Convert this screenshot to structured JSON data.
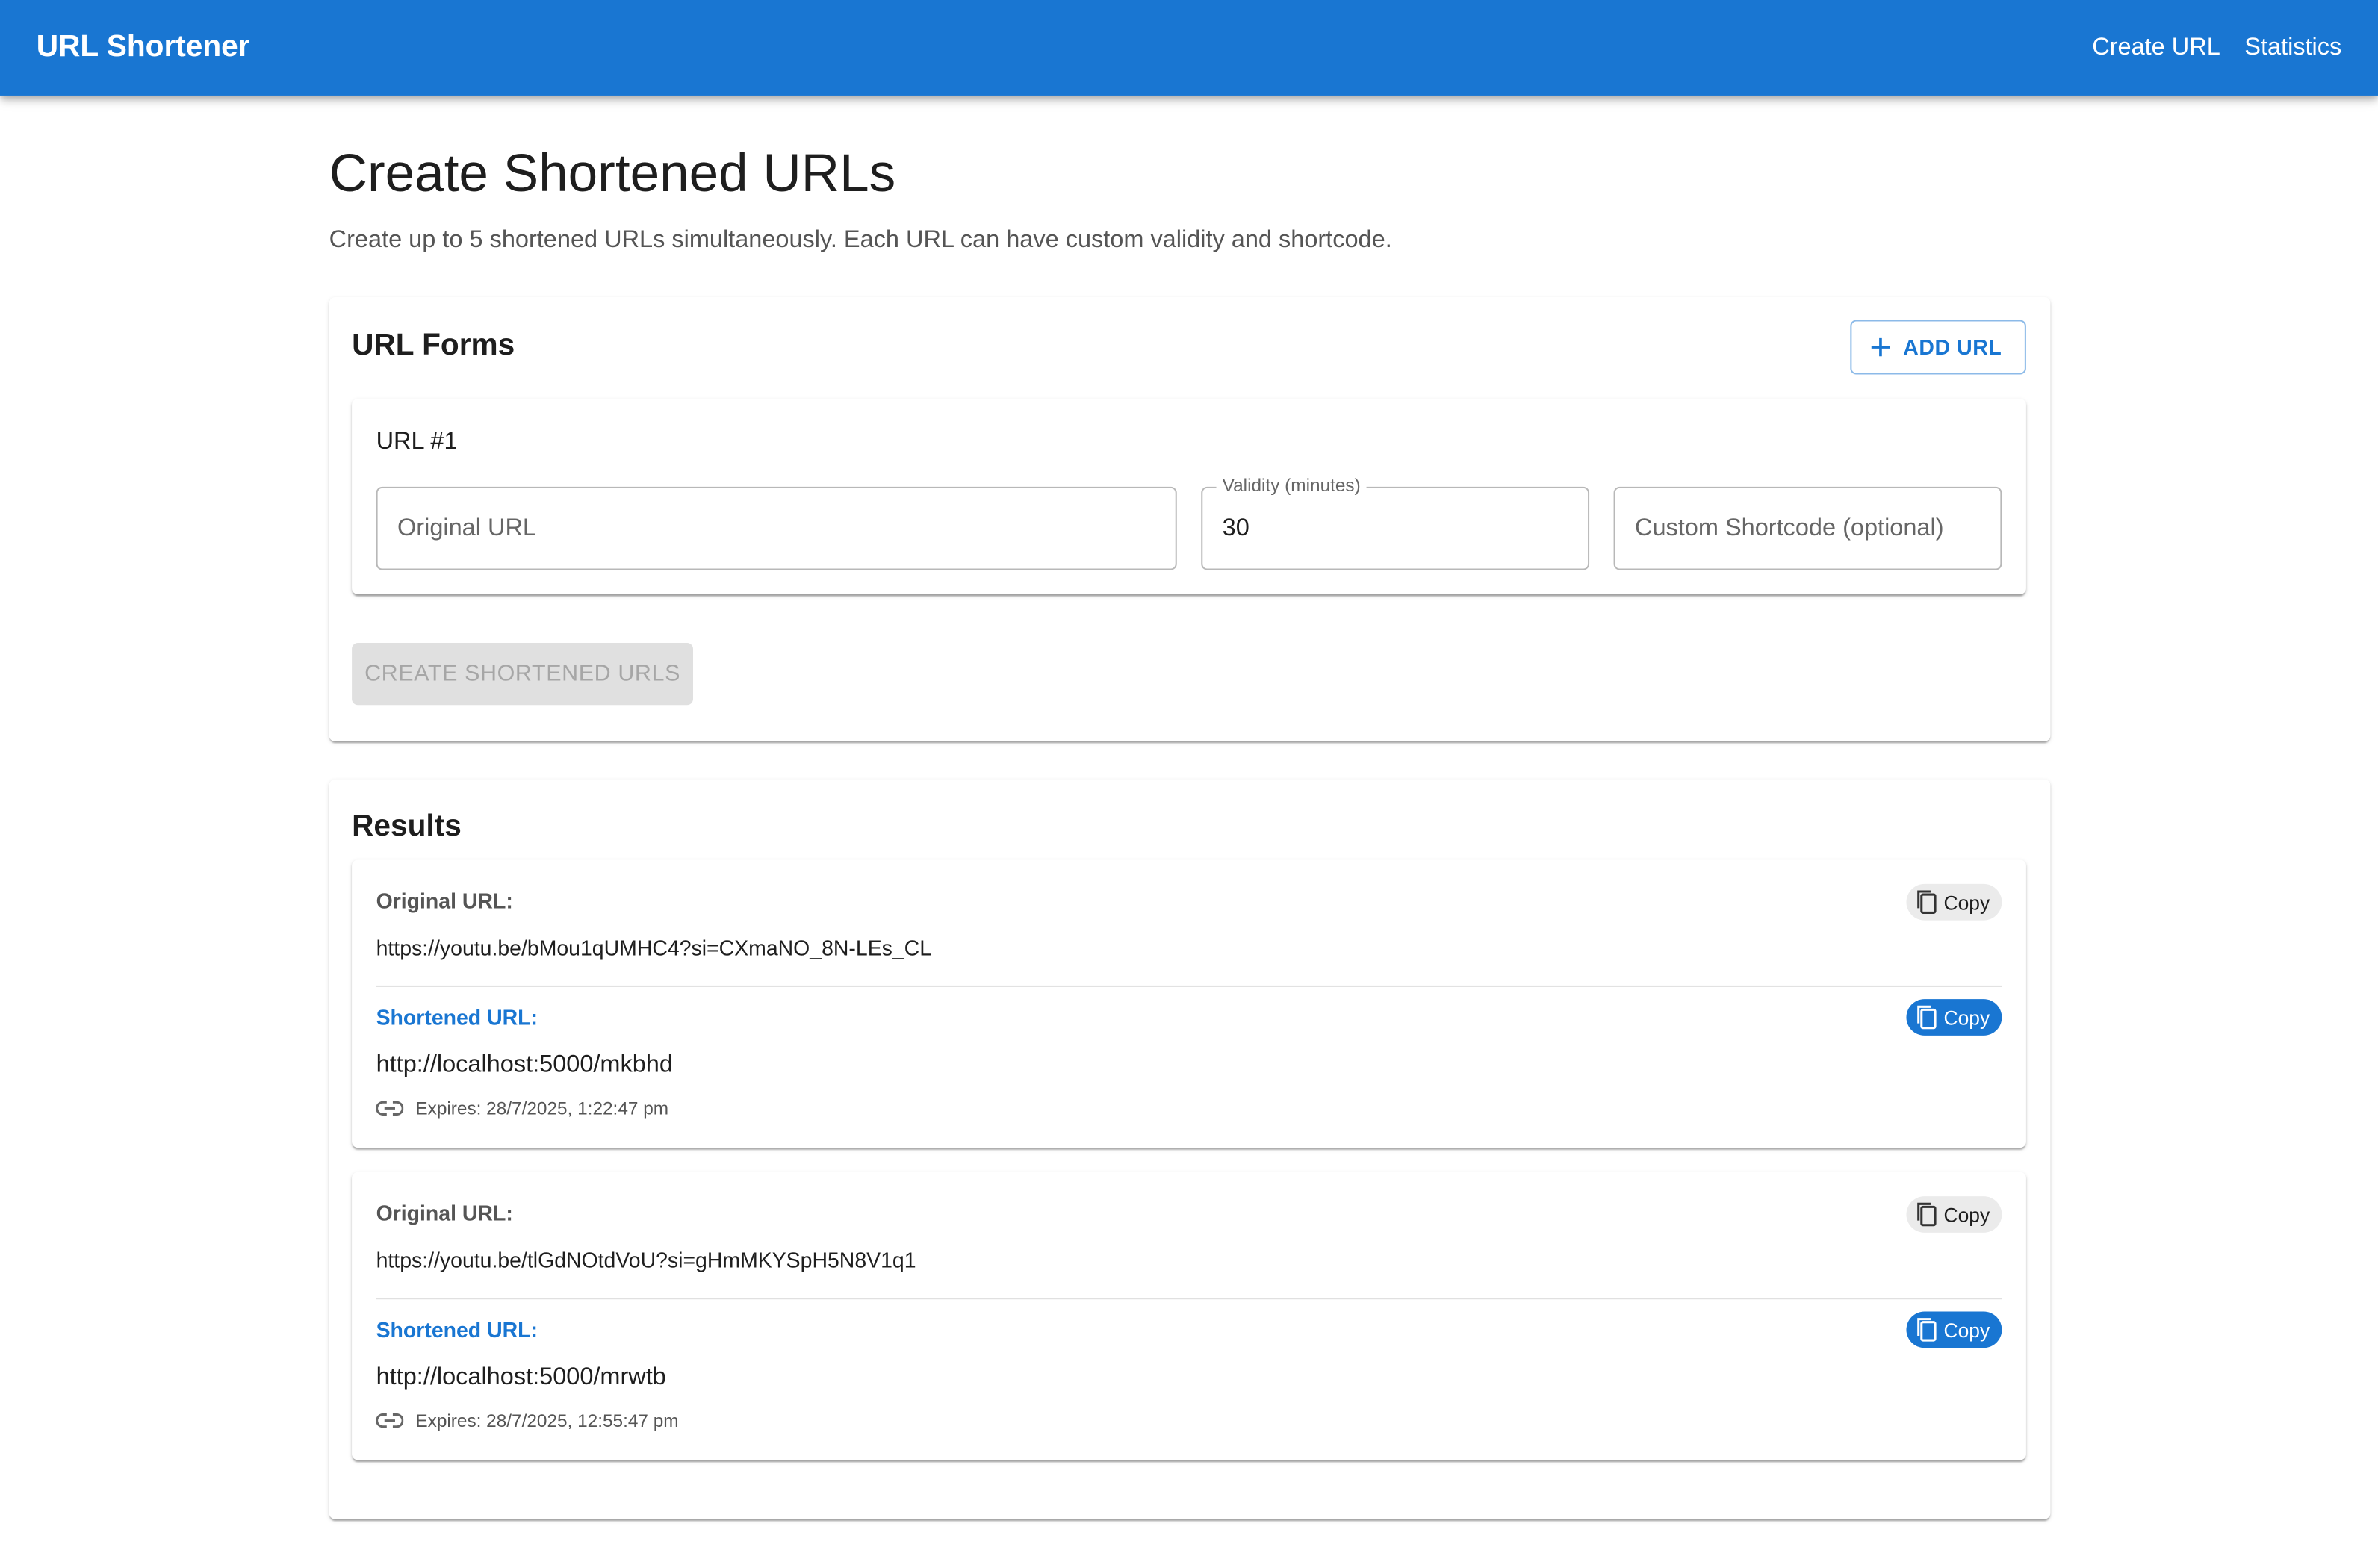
{
  "header": {
    "title": "URL Shortener",
    "nav": [
      "Create URL",
      "Statistics"
    ]
  },
  "page": {
    "title": "Create Shortened URLs",
    "subtitle": "Create up to 5 shortened URLs simultaneously. Each URL can have custom validity and shortcode."
  },
  "forms": {
    "title": "URL Forms",
    "add_label": "ADD URL",
    "items": [
      {
        "label": "URL #1",
        "original_placeholder": "Original URL",
        "validity_label": "Validity (minutes)",
        "validity_value": "30",
        "shortcode_placeholder": "Custom Shortcode (optional)"
      }
    ],
    "create_label": "CREATE SHORTENED URLS"
  },
  "results": {
    "title": "Results",
    "original_label": "Original URL:",
    "shortened_label": "Shortened URL:",
    "copy_label": "Copy",
    "items": [
      {
        "original": "https://youtu.be/bMou1qUMHC4?si=CXmaNO_8N-LEs_CL",
        "shortened": "http://localhost:5000/mkbhd",
        "expires": "Expires: 28/7/2025, 1:22:47 pm"
      },
      {
        "original": "https://youtu.be/tlGdNOtdVoU?si=gHmMKYSpH5N8V1q1",
        "shortened": "http://localhost:5000/mrwtb",
        "expires": "Expires: 28/7/2025, 12:55:47 pm"
      }
    ]
  },
  "colors": {
    "primary": "#1976d2",
    "disabled_bg": "#e0e0e0",
    "chip_grey": "#ebebeb"
  }
}
